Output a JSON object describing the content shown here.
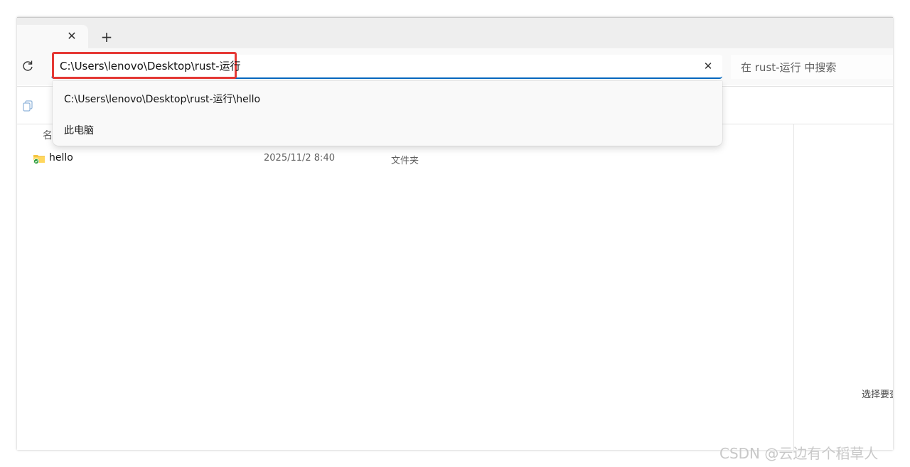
{
  "tabbar": {
    "close_glyph": "✕",
    "new_tab_glyph": "+"
  },
  "addressbar": {
    "path": "C:\\Users\\lenovo\\Desktop\\rust-运行",
    "clear_glyph": "✕",
    "search_placeholder": "在 rust-运行 中搜索",
    "accent_color": "#0067c0",
    "highlight_color": "#e53935"
  },
  "suggestions": [
    {
      "label": "C:\\Users\\lenovo\\Desktop\\rust-运行\\hello"
    },
    {
      "label": "此电脑"
    }
  ],
  "file_list": {
    "name_header_partial": "名",
    "rows": [
      {
        "name": "hello",
        "modified": "2025/11/2 8:40",
        "type": "文件夹"
      }
    ]
  },
  "details_pane": {
    "hint_text": "选择要查看的文件"
  },
  "watermark": "CSDN @云边有个稻草人",
  "icons": {
    "refresh": "refresh-icon",
    "copy": "copy-icon",
    "folder": "folder-icon",
    "sync_status": "sync-check-icon"
  }
}
